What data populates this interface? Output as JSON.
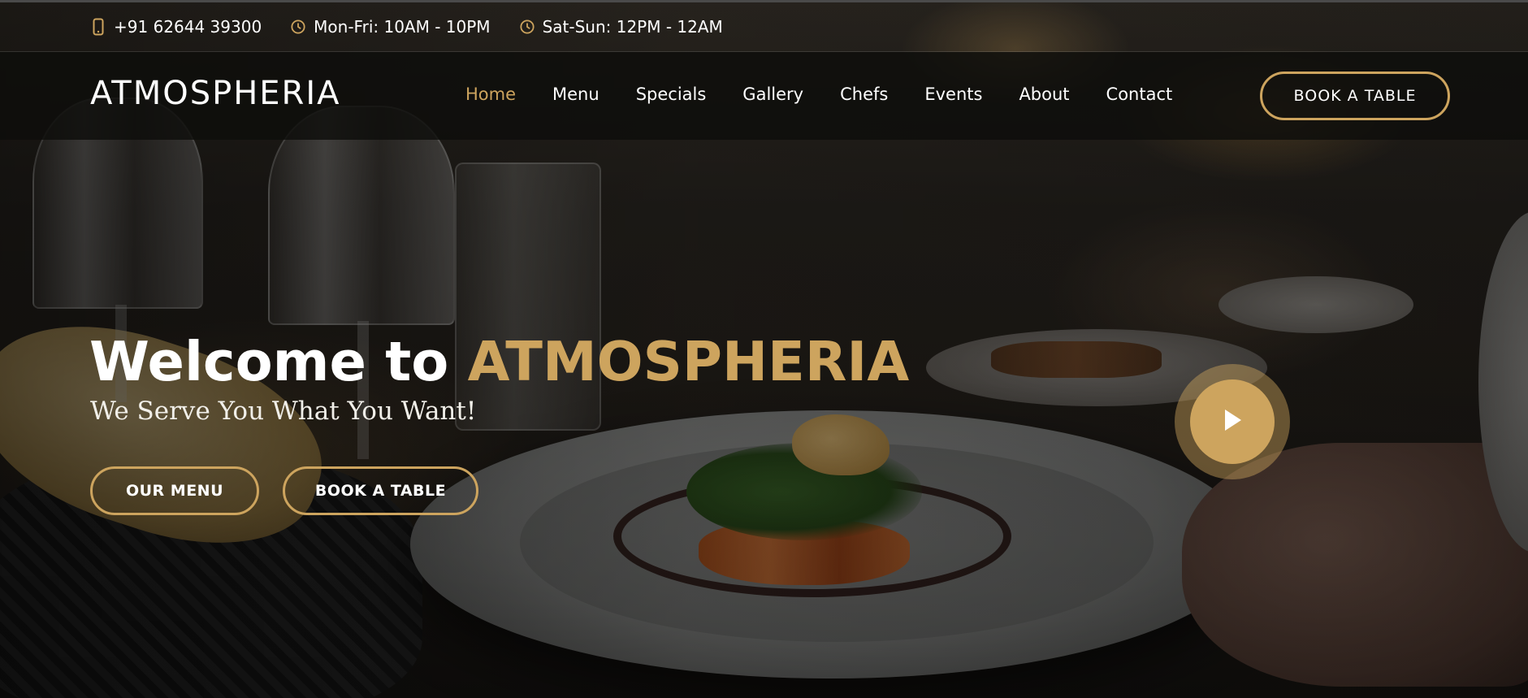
{
  "topbar": {
    "phone": "+91 62644 39300",
    "weekday_hours": "Mon-Fri: 10AM - 10PM",
    "weekend_hours": "Sat-Sun: 12PM - 12AM",
    "icons": {
      "phone": "phone-icon",
      "clock": "clock-icon"
    }
  },
  "header": {
    "logo": "ATMOSPHERIA",
    "nav": [
      {
        "label": "Home",
        "active": true
      },
      {
        "label": "Menu",
        "active": false
      },
      {
        "label": "Specials",
        "active": false
      },
      {
        "label": "Gallery",
        "active": false
      },
      {
        "label": "Chefs",
        "active": false
      },
      {
        "label": "Events",
        "active": false
      },
      {
        "label": "About",
        "active": false
      },
      {
        "label": "Contact",
        "active": false
      }
    ],
    "cta_label": "BOOK A TABLE"
  },
  "hero": {
    "title_prefix": "Welcome to ",
    "title_brand": "ATMOSPHERIA",
    "subtitle": "We Serve You What You Want!",
    "menu_button": "OUR MENU",
    "book_button": "BOOK A TABLE",
    "play_icon": "play-icon"
  },
  "colors": {
    "accent": "#cda45e",
    "header_bg": "#0e0d0b",
    "text": "#ffffff"
  }
}
